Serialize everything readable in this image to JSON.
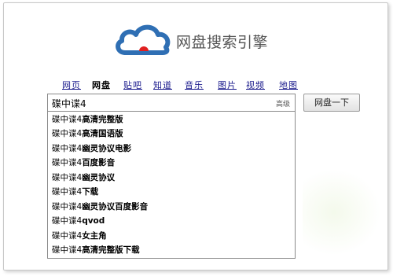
{
  "logo": {
    "title": "网盘搜索引擎",
    "icon": "cloud-icon",
    "colors": {
      "cloud": "#2f6fb4",
      "dot": "#e02020"
    }
  },
  "nav": {
    "items": [
      {
        "label": "网页",
        "active": false
      },
      {
        "label": "网盘",
        "active": true
      },
      {
        "label": "贴吧",
        "active": false
      },
      {
        "label": "知道",
        "active": false
      },
      {
        "label": "音乐",
        "active": false
      },
      {
        "label": "图片",
        "active": false
      },
      {
        "label": "视频",
        "active": false
      },
      {
        "label": "地图",
        "active": false
      }
    ]
  },
  "search": {
    "value": "碟中谍4",
    "advanced_label": "高级",
    "button_label": "网盘一下"
  },
  "suggestions": {
    "prefix": "碟中谍4",
    "items": [
      "高清完整版",
      "高清国语版",
      "幽灵协议电影",
      "百度影音",
      "幽灵协议",
      "下载",
      "幽灵协议百度影音",
      "qvod",
      "女主角",
      "高清完整版下载"
    ]
  }
}
